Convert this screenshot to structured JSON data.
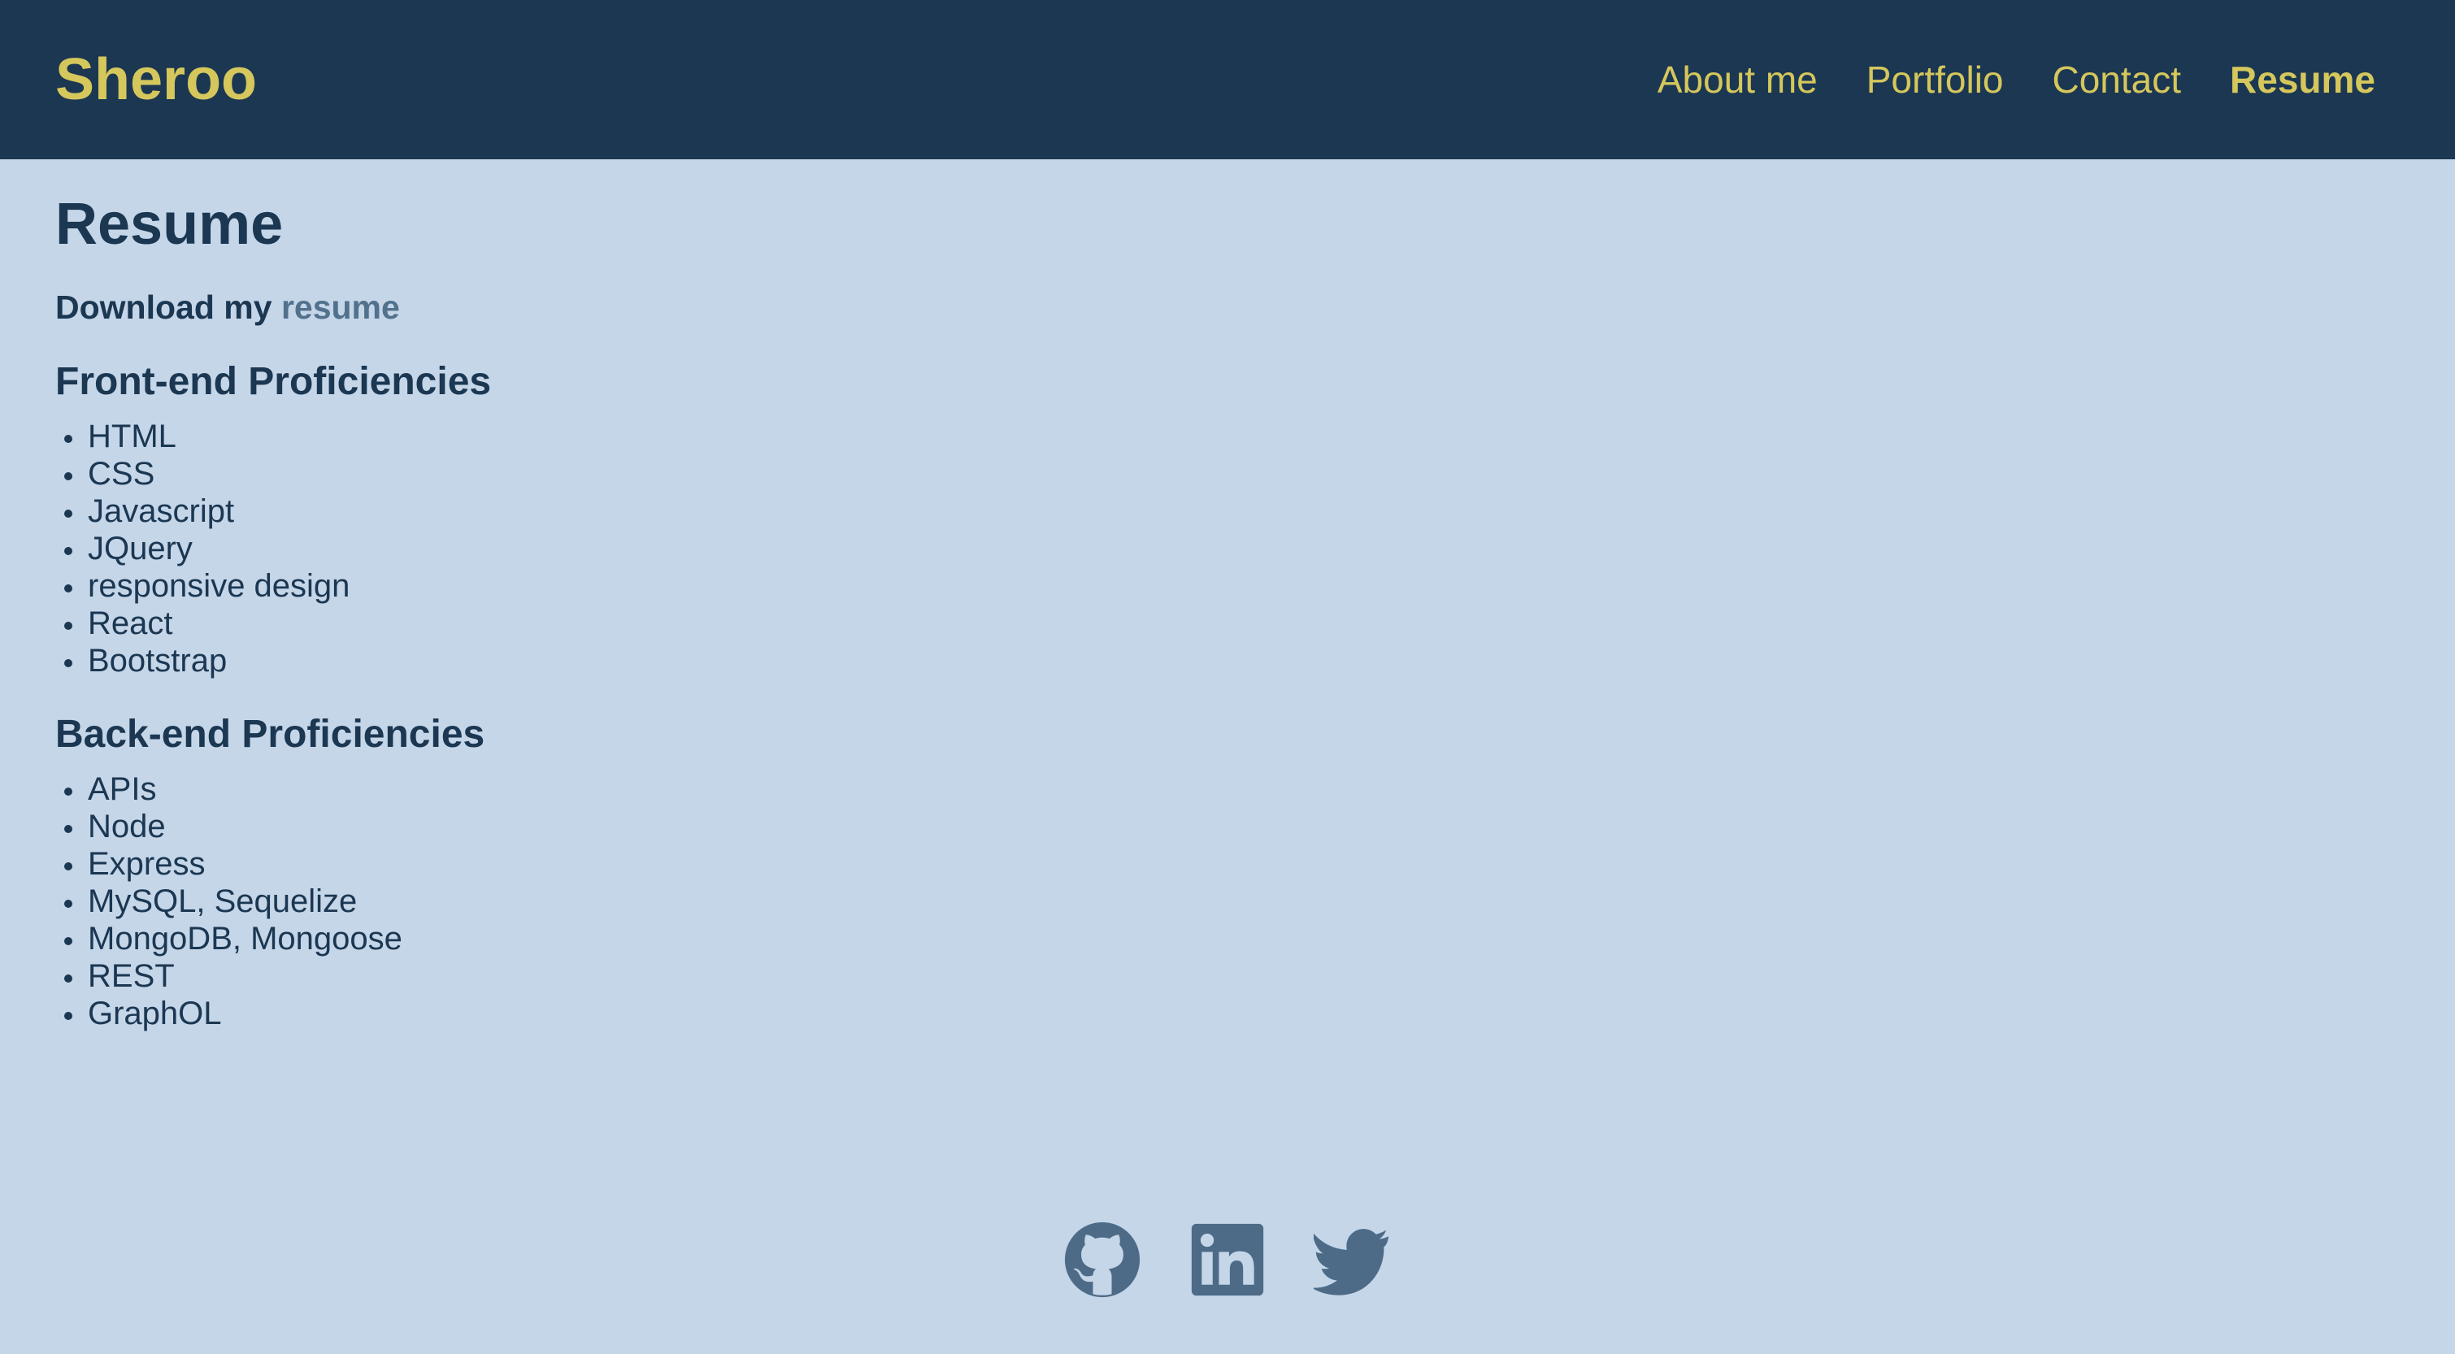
{
  "header": {
    "brand": "Sheroo",
    "nav": [
      {
        "label": "About me"
      },
      {
        "label": "Portfolio"
      },
      {
        "label": "Contact"
      },
      {
        "label": "Resume"
      }
    ]
  },
  "main": {
    "title": "Resume",
    "download_prefix": "Download my",
    "download_link": "resume",
    "frontend": {
      "title": "Front-end Proficiencies",
      "items": [
        "HTML",
        "CSS",
        "Javascript",
        "JQuery",
        "responsive design",
        "React",
        "Bootstrap"
      ]
    },
    "backend": {
      "title": "Back-end Proficiencies",
      "items": [
        "APIs",
        "Node",
        "Express",
        "MySQL, Sequelize",
        "MongoDB, Mongoose",
        "REST",
        "GraphOL"
      ]
    }
  },
  "footer": {
    "icons": [
      "github-icon",
      "linkedin-icon",
      "twitter-icon"
    ]
  },
  "colors": {
    "header_bg": "#1b3752",
    "page_bg": "#c5d6e8",
    "accent": "#d5c75c",
    "text": "#1b3752",
    "link": "#52718d",
    "icon": "#4d6b87"
  }
}
